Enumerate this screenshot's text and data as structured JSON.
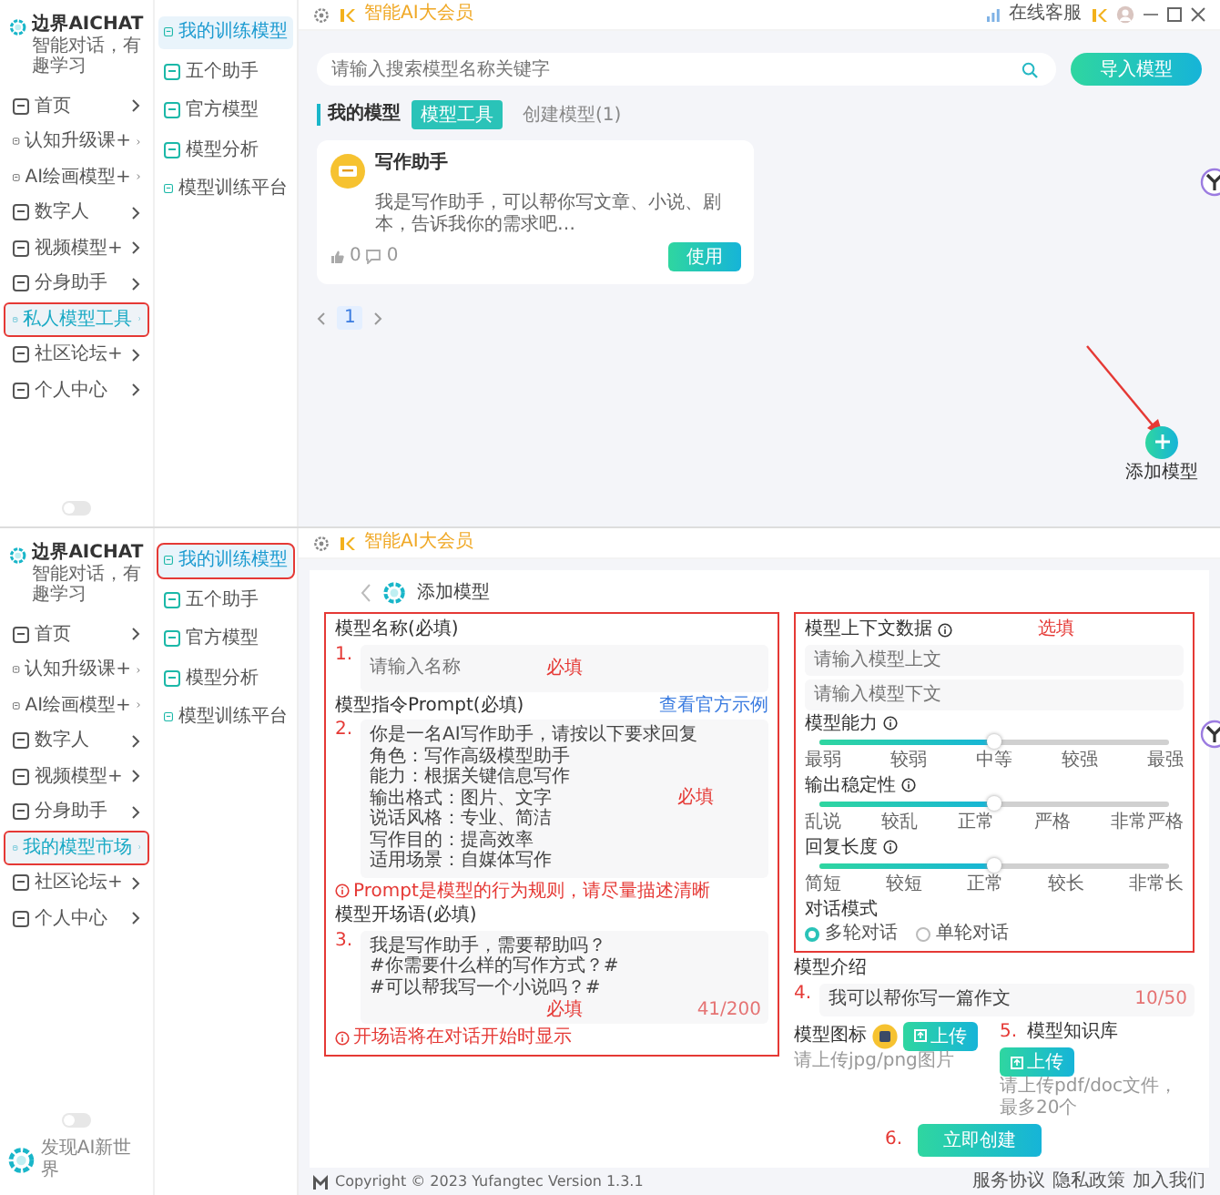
{
  "list_screen": {
    "sidebar": {
      "brand": "边界AICHAT",
      "tagline": "智能对话，有趣学习",
      "items": [
        {
          "label": "首页",
          "selected": false,
          "annotated": false
        },
        {
          "label": "认知升级课+",
          "selected": false,
          "annotated": false
        },
        {
          "label": "AI绘画模型+",
          "selected": false,
          "annotated": false
        },
        {
          "label": "数字人",
          "selected": false,
          "annotated": false
        },
        {
          "label": "视频模型+",
          "selected": false,
          "annotated": false
        },
        {
          "label": "分身助手",
          "selected": false,
          "annotated": false
        },
        {
          "label": "私人模型工具",
          "selected": true,
          "annotated": true
        },
        {
          "label": "社区论坛+",
          "selected": false,
          "annotated": false
        },
        {
          "label": "个人中心",
          "selected": false,
          "annotated": false
        }
      ],
      "theme_switch": {
        "on": false
      }
    },
    "submenu": [
      {
        "label": "我的训练模型",
        "selected": true,
        "annotated": false
      },
      {
        "label": "五个助手",
        "selected": false,
        "annotated": false
      },
      {
        "label": "官方模型",
        "selected": false,
        "annotated": false
      },
      {
        "label": "模型分析",
        "selected": false,
        "annotated": false
      },
      {
        "label": "模型训练平台",
        "selected": false,
        "annotated": false
      }
    ],
    "topbar": {
      "member": "智能AI大会员",
      "service": "在线客服"
    },
    "search": {
      "placeholder": "请输入搜索模型名称关键字"
    },
    "import_button": "导入模型",
    "section_title": "我的模型",
    "tabs": [
      {
        "label": "模型工具",
        "selected": true
      },
      {
        "label": "创建模型(1)",
        "selected": false
      }
    ],
    "cards": [
      {
        "title": "写作助手",
        "description": "我是写作助手，可以帮你写文章、小说、剧本，告诉我你的需求吧…",
        "likes": "0",
        "comments": "0",
        "button": "使用"
      }
    ],
    "pagination": [
      {
        "label": "1",
        "selected": true
      }
    ],
    "add_button_label": "添加模型"
  },
  "form_screen": {
    "sidebar": {
      "brand": "边界AICHAT",
      "tagline": "智能对话，有趣学习",
      "items": [
        {
          "label": "首页",
          "selected": false,
          "annotated": false
        },
        {
          "label": "认知升级课+",
          "selected": false,
          "annotated": false
        },
        {
          "label": "AI绘画模型+",
          "selected": false,
          "annotated": false
        },
        {
          "label": "数字人",
          "selected": false,
          "annotated": false
        },
        {
          "label": "视频模型+",
          "selected": false,
          "annotated": false
        },
        {
          "label": "分身助手",
          "selected": false,
          "annotated": false
        },
        {
          "label": "我的模型市场",
          "selected": true,
          "annotated": true
        },
        {
          "label": "社区论坛+",
          "selected": false,
          "annotated": false
        },
        {
          "label": "个人中心",
          "selected": false,
          "annotated": false
        }
      ],
      "theme_switch": {
        "on": false
      },
      "footer_text": "发现AI新世界"
    },
    "submenu": [
      {
        "label": "我的训练模型",
        "selected": true,
        "annotated": true
      },
      {
        "label": "五个助手",
        "selected": false,
        "annotated": false
      },
      {
        "label": "官方模型",
        "selected": false,
        "annotated": false
      },
      {
        "label": "模型分析",
        "selected": false,
        "annotated": false
      },
      {
        "label": "模型训练平台",
        "selected": false,
        "annotated": false
      }
    ],
    "topbar": {
      "member": "智能AI大会员"
    },
    "form": {
      "title": "添加模型",
      "name": {
        "number": "1.",
        "label": "模型名称(必填)",
        "placeholder": "请输入名称",
        "note": "必填"
      },
      "prompt": {
        "number": "2.",
        "label": "模型指令Prompt(必填)",
        "link": "查看官方示例",
        "lines": [
          "你是一名AI写作助手，请按以下要求回复",
          "角色：写作高级模型助手",
          "能力：根据关键信息写作",
          "输出格式：图片、文字",
          "说话风格：专业、简洁",
          "写作目的：提高效率",
          "适用场景：自媒体写作"
        ],
        "note": "必填",
        "hint": "Prompt是模型的行为规则，请尽量描述清晰"
      },
      "opener": {
        "number": "3.",
        "label": "模型开场语(必填)",
        "lines": [
          "我是写作助手，需要帮助吗？",
          "#你需要什么样的写作方式？#",
          "#可以帮我写一个小说吗？#"
        ],
        "note": "必填",
        "counter": "41/200",
        "hint": "开场语将在对话开始时显示"
      },
      "context": {
        "label": "模型上下文数据",
        "fields": [
          {
            "placeholder": "请输入模型上文"
          },
          {
            "placeholder": "请输入模型下文"
          }
        ],
        "note": "选填"
      },
      "sliders": [
        {
          "label": "模型能力",
          "level": 0.5,
          "ticks": [
            "最弱",
            "较弱",
            "中等",
            "较强",
            "最强"
          ]
        },
        {
          "label": "输出稳定性",
          "level": 0.5,
          "ticks": [
            "乱说",
            "较乱",
            "正常",
            "严格",
            "非常严格"
          ]
        },
        {
          "label": "回复长度",
          "level": 0.5,
          "ticks": [
            "简短",
            "较短",
            "正常",
            "较长",
            "非常长"
          ]
        }
      ],
      "mode": {
        "label": "对话模式",
        "options": [
          {
            "label": "多轮对话",
            "selected": true
          },
          {
            "label": "单轮对话",
            "selected": false
          }
        ]
      },
      "intro": {
        "number": "4.",
        "label": "模型介绍",
        "value": "我可以帮你写一篇作文",
        "counter": "10/50"
      },
      "uploads": [
        {
          "kind": "icon",
          "label": "模型图标",
          "button": "上传",
          "hint": "请上传jpg/png图片"
        },
        {
          "kind": "file",
          "number": "5.",
          "label": "模型知识库",
          "button": "上传",
          "hint": "请上传pdf/doc文件，最多20个"
        }
      ],
      "submit": {
        "number": "6.",
        "label": "立即创建"
      }
    },
    "footer": {
      "copyright": "Copyright © 2023 Yufangtec Version 1.3.1",
      "links": [
        "服务协议",
        "隐私政策",
        "加入我们"
      ]
    }
  }
}
